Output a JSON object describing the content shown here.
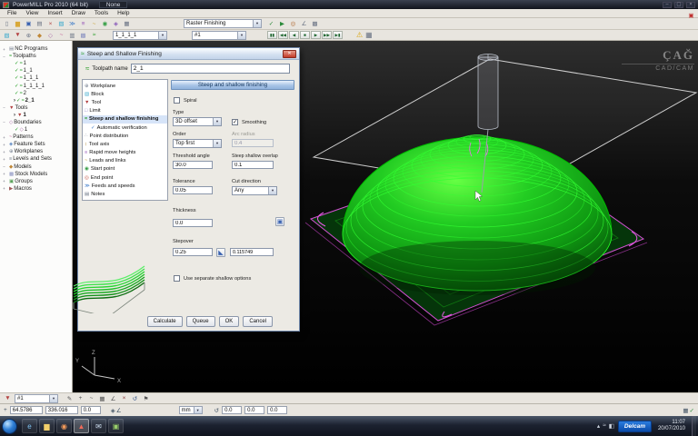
{
  "titlebar": {
    "title": "PowerMILL Pro 2010 (64 bit)",
    "project": "None",
    "controls": [
      {
        "name": "minimize-button",
        "glyph": "–"
      },
      {
        "name": "maximize-button",
        "glyph": "▢"
      },
      {
        "name": "close-button",
        "glyph": "×"
      }
    ]
  },
  "menubar": {
    "items": [
      "File",
      "View",
      "Insert",
      "Draw",
      "Tools",
      "Help"
    ],
    "right_icons": [
      {
        "name": "paf-status-icon",
        "glyph": "▣",
        "color": "#c03030"
      }
    ]
  },
  "toolbar1": {
    "strategy_value": "Raster Finishing",
    "icons_left": [
      {
        "name": "new-project-icon",
        "glyph": "▯",
        "color": "#6a7384"
      },
      {
        "name": "open-project-icon",
        "glyph": "▆",
        "color": "#d8a838"
      },
      {
        "name": "save-project-icon",
        "glyph": "▣",
        "color": "#3a62b0"
      },
      {
        "name": "print-icon",
        "glyph": "▤",
        "color": "#6a7384"
      },
      {
        "name": "delete-entity-icon",
        "glyph": "×",
        "color": "#b04040"
      },
      {
        "name": "block-form-icon",
        "glyph": "▧",
        "color": "#38a8cc"
      },
      {
        "name": "feed-rate-icon",
        "glyph": "≫",
        "color": "#3878c8"
      },
      {
        "name": "rapid-heights-icon",
        "glyph": "≡",
        "color": "#9858b8"
      },
      {
        "name": "leads-links-icon",
        "glyph": "~",
        "color": "#c8a030"
      },
      {
        "name": "start-end-point-icon",
        "glyph": "◉",
        "color": "#38a048"
      },
      {
        "name": "strategy-selector-icon",
        "glyph": "◈",
        "color": "#8858b8"
      },
      {
        "name": "calculator-icon",
        "glyph": "▦",
        "color": "#6a7384"
      }
    ],
    "icons_right": [
      {
        "name": "toolpath-verify-icon",
        "glyph": "✓",
        "color": "#2a8a3a"
      },
      {
        "name": "simulation-icon",
        "glyph": "▶",
        "color": "#2a8a3a"
      },
      {
        "name": "viewmill-icon",
        "glyph": "◎",
        "color": "#b06830"
      },
      {
        "name": "measure-icon",
        "glyph": "∠",
        "color": "#6a7384"
      },
      {
        "name": "options-icon",
        "glyph": "▩",
        "color": "#6a7384"
      }
    ]
  },
  "toolbar2": {
    "toolpath_value": "1_1_1_1",
    "tool_value": "#1",
    "icons_left": [
      {
        "name": "block-icon",
        "glyph": "▧",
        "color": "#38a8cc"
      },
      {
        "name": "tool-icon",
        "glyph": "▼",
        "color": "#b34040"
      },
      {
        "name": "workplane-icon",
        "glyph": "⊕",
        "color": "#6a7384"
      },
      {
        "name": "model-icon",
        "glyph": "◆",
        "color": "#c08838"
      },
      {
        "name": "boundary-icon",
        "glyph": "◇",
        "color": "#a566a5"
      },
      {
        "name": "pattern-icon",
        "glyph": "~",
        "color": "#c05890"
      },
      {
        "name": "nc-program-icon",
        "glyph": "▥",
        "color": "#6a7384"
      },
      {
        "name": "stock-model-icon",
        "glyph": "▩",
        "color": "#8890c0"
      },
      {
        "name": "toolpath-icon",
        "glyph": "≈",
        "color": "#1f9a1f"
      }
    ],
    "playback": [
      {
        "name": "sim-pause-icon",
        "glyph": "▮▮"
      },
      {
        "name": "sim-step-back-icon",
        "glyph": "◀◀"
      },
      {
        "name": "sim-back-icon",
        "glyph": "◀"
      },
      {
        "name": "sim-stop-icon",
        "glyph": "■"
      },
      {
        "name": "sim-play-icon",
        "glyph": "▶"
      },
      {
        "name": "sim-forward-icon",
        "glyph": "▶▶"
      },
      {
        "name": "sim-to-end-icon",
        "glyph": "▶▮"
      }
    ],
    "icons_right": [
      {
        "name": "simulation-warning-icon",
        "glyph": "⚠",
        "color": "#d8a510"
      },
      {
        "name": "sim-settings-icon",
        "glyph": "▦",
        "color": "#6a7384"
      }
    ]
  },
  "explorer": {
    "items": [
      {
        "label": "NC Programs",
        "level": 0,
        "icon": "nc-programs-icon",
        "glyph": "▤",
        "color": "#7a8494",
        "expander": "+"
      },
      {
        "label": "Toolpaths",
        "level": 0,
        "icon": "toolpaths-icon",
        "glyph": "≈",
        "color": "#1f9a1f",
        "expander": "−"
      },
      {
        "label": "1",
        "level": 1,
        "icon": "toolpath-icon",
        "glyph": "≈",
        "color": "#1f9a1f",
        "check": "✓"
      },
      {
        "label": "1_1",
        "level": 1,
        "icon": "toolpath-icon",
        "glyph": "≈",
        "color": "#1f9a1f",
        "check": "✓"
      },
      {
        "label": "1_1_1",
        "level": 1,
        "icon": "toolpath-icon",
        "glyph": "≈",
        "color": "#1f9a1f",
        "check": "✓"
      },
      {
        "label": "1_1_1_1",
        "level": 1,
        "icon": "toolpath-icon",
        "glyph": "≈",
        "color": "#1f9a1f",
        "check": "✓"
      },
      {
        "label": "2",
        "level": 1,
        "icon": "toolpath-icon",
        "glyph": "≈",
        "color": "#1f9a1f",
        "check": "✓"
      },
      {
        "label": "2_1",
        "level": 1,
        "icon": "toolpath-icon",
        "glyph": "≈",
        "color": "#1f9a1f",
        "check": "✓",
        "prefix": "›",
        "active": true
      },
      {
        "label": "Tools",
        "level": 0,
        "icon": "tools-icon",
        "glyph": "▼",
        "color": "#b34040",
        "expander": "−"
      },
      {
        "label": "1",
        "level": 1,
        "icon": "tool-icon",
        "glyph": "▼",
        "color": "#b34040",
        "prefix": "›",
        "active": true
      },
      {
        "label": "Boundaries",
        "level": 0,
        "icon": "boundaries-icon",
        "glyph": "◇",
        "color": "#a566a5",
        "expander": "−"
      },
      {
        "label": "1",
        "level": 1,
        "icon": "boundary-icon",
        "glyph": "◇",
        "color": "#a566a5",
        "check": "✓"
      },
      {
        "label": "Patterns",
        "level": 0,
        "icon": "patterns-icon",
        "glyph": "~",
        "color": "#c05890",
        "expander": "+"
      },
      {
        "label": "Feature Sets",
        "level": 0,
        "icon": "feature-sets-icon",
        "glyph": "◈",
        "color": "#5884c0",
        "expander": "+"
      },
      {
        "label": "Workplanes",
        "level": 0,
        "icon": "workplanes-icon",
        "glyph": "⊕",
        "color": "#7a8494",
        "expander": "+"
      },
      {
        "label": "Levels and Sets",
        "level": 0,
        "icon": "levels-icon",
        "glyph": "≡",
        "color": "#6a7484",
        "expander": "+"
      },
      {
        "label": "Models",
        "level": 0,
        "icon": "models-icon",
        "glyph": "◆",
        "color": "#c08838",
        "expander": "−"
      },
      {
        "label": "Stock Models",
        "level": 0,
        "icon": "stock-models-icon",
        "glyph": "▩",
        "color": "#8890c0",
        "expander": "+"
      },
      {
        "label": "Groups",
        "level": 0,
        "icon": "groups-icon",
        "glyph": "▣",
        "color": "#58a058",
        "expander": "+"
      },
      {
        "label": "Macros",
        "level": 0,
        "icon": "macros-icon",
        "glyph": "▶",
        "color": "#a05858",
        "expander": "+"
      }
    ]
  },
  "dialog": {
    "title": "Steep and Shallow Finishing",
    "title_icon": "≈",
    "close_glyph": "✕",
    "name_label": "Toolpath name",
    "name_value": "2_1",
    "name_icon": "≈",
    "tree": [
      {
        "label": "Workplane",
        "level": 0,
        "icon": "workplane-icon",
        "glyph": "⊕",
        "color": "#7a8494"
      },
      {
        "label": "Block",
        "level": 0,
        "icon": "block-icon",
        "glyph": "▧",
        "color": "#38a8cc"
      },
      {
        "label": "Tool",
        "level": 0,
        "icon": "tool-icon",
        "glyph": "▼",
        "color": "#b34040"
      },
      {
        "label": "Limit",
        "level": 0,
        "icon": "limit-icon",
        "glyph": "□",
        "color": "#8878c0"
      },
      {
        "label": "Steep and shallow finishing",
        "level": 0,
        "icon": "strategy-icon",
        "glyph": "≈",
        "color": "#1f9a1f",
        "selected": true
      },
      {
        "label": "Automatic verification",
        "level": 1,
        "icon": "verification-icon",
        "glyph": "✓",
        "color": "#3a78c8"
      },
      {
        "label": "Point distribution",
        "level": 0,
        "icon": "point-distribution-icon",
        "glyph": "∴",
        "color": "#6a7484"
      },
      {
        "label": "Tool axis",
        "level": 0,
        "icon": "tool-axis-icon",
        "glyph": "↕",
        "color": "#b08838"
      },
      {
        "label": "Rapid move heights",
        "level": 0,
        "icon": "rapid-heights-icon",
        "glyph": "≡",
        "color": "#9858b8"
      },
      {
        "label": "Leads and links",
        "level": 0,
        "icon": "leads-links-icon",
        "glyph": "~",
        "color": "#c8a030"
      },
      {
        "label": "Start point",
        "level": 0,
        "icon": "start-point-icon",
        "glyph": "◉",
        "color": "#2f9a3f"
      },
      {
        "label": "End point",
        "level": 0,
        "icon": "end-point-icon",
        "glyph": "◎",
        "color": "#c04838"
      },
      {
        "label": "Feeds and speeds",
        "level": 0,
        "icon": "feeds-speeds-icon",
        "glyph": "≫",
        "color": "#3878c8"
      },
      {
        "label": "Notes",
        "level": 0,
        "icon": "notes-icon",
        "glyph": "▤",
        "color": "#6a7484"
      }
    ],
    "section_header": "Steep and shallow finishing",
    "spiral_label": "Spiral",
    "spiral_check": "",
    "type_label": "Type",
    "type_value": "3D offset",
    "smoothing_label": "Smoothing",
    "smoothing_check": "✓",
    "order_label": "Order",
    "order_value": "Top first",
    "arc_label": "Arc radius",
    "arc_value": "0.4",
    "threshold_label": "Threshold angle",
    "threshold_value": "30.0",
    "overlap_label": "Steep shallow overlap",
    "overlap_value": "0.1",
    "tolerance_label": "Tolerance",
    "tolerance_value": "0.05",
    "cutdir_label": "Cut direction",
    "cutdir_value": "Any",
    "thickness_label": "Thickness",
    "thickness_value": "0.0",
    "stepover_label": "Stepover",
    "stepover_value": "0.25",
    "cusp_value": "0.115749",
    "separate_label": "Use separate shallow options",
    "separate_check": "",
    "buttons": [
      {
        "name": "calculate-button",
        "label": "Calculate"
      },
      {
        "name": "queue-button",
        "label": "Queue"
      },
      {
        "name": "ok-button",
        "label": "OK"
      },
      {
        "name": "cancel-button",
        "label": "Cancel"
      }
    ]
  },
  "viewport": {
    "watermark_title": "ÇAĞ",
    "watermark_sub": "CAD/CAM",
    "axis_x": "X",
    "axis_y": "Y",
    "axis_z": "Z"
  },
  "bottom_toolbar": {
    "combo_value": "#1",
    "lead_icon": {
      "name": "active-tool-icon",
      "glyph": "▼",
      "color": "#b34040"
    },
    "icons": [
      {
        "name": "edit-toolpath-icon",
        "glyph": "✎",
        "color": "#555555"
      },
      {
        "name": "add-icon",
        "glyph": "+",
        "color": "#555555"
      },
      {
        "name": "curve-editor-icon",
        "glyph": "~",
        "color": "#555555"
      },
      {
        "name": "grid-icon",
        "glyph": "▦",
        "color": "#555555"
      },
      {
        "name": "measure-icon",
        "glyph": "∠",
        "color": "#555555"
      },
      {
        "name": "delete-icon",
        "glyph": "×",
        "color": "#883333"
      },
      {
        "name": "refresh-icon",
        "glyph": "↺",
        "color": "#335588"
      },
      {
        "name": "flag-icon",
        "glyph": "⚑",
        "color": "#555555"
      }
    ]
  },
  "statusbar": {
    "x": "64.5786",
    "y": "336.016",
    "z": "0.0",
    "units": "mm",
    "v1": "0.0",
    "v2": "0.0",
    "v3": "0.0",
    "icons_left": [
      {
        "name": "cursor-position-icon",
        "glyph": "+",
        "color": "#445566"
      }
    ],
    "icons_mid": [
      {
        "name": "snap-icon",
        "glyph": "◈",
        "color": "#445566"
      },
      {
        "name": "angle-icon",
        "glyph": "∠",
        "color": "#445566"
      }
    ],
    "icons_mid2": [
      {
        "name": "refresh-icon",
        "glyph": "↺",
        "color": "#445566"
      }
    ],
    "icons_right": [
      {
        "name": "grid-toggle-icon",
        "glyph": "▦",
        "color": "#445566"
      },
      {
        "name": "ok-state-icon",
        "glyph": "✓",
        "color": "#2a8a3a"
      }
    ]
  },
  "taskbar": {
    "brand": "Delcam",
    "time": "11:07",
    "date": "20/07/2010",
    "apps": [
      {
        "name": "internet-explorer-icon",
        "glyph": "e",
        "color": "#7ec3f2"
      },
      {
        "name": "windows-explorer-icon",
        "glyph": "▆",
        "color": "#f2cf6a"
      },
      {
        "name": "media-player-icon",
        "glyph": "◉",
        "color": "#f29a5a"
      },
      {
        "name": "powermill-icon",
        "glyph": "▲",
        "color": "#f06a5a",
        "active": true
      },
      {
        "name": "document-icon",
        "glyph": "✉",
        "color": "#cfe0f2"
      },
      {
        "name": "viewer-icon",
        "glyph": "▣",
        "color": "#9ad06a"
      }
    ],
    "tray_icons": [
      {
        "name": "tray-expand-icon",
        "glyph": "▴",
        "color": "#cfd6e2"
      },
      {
        "name": "network-icon",
        "glyph": "≈",
        "color": "#cfd6e2"
      },
      {
        "name": "volume-icon",
        "glyph": "◧",
        "color": "#cfd6e2"
      }
    ]
  }
}
